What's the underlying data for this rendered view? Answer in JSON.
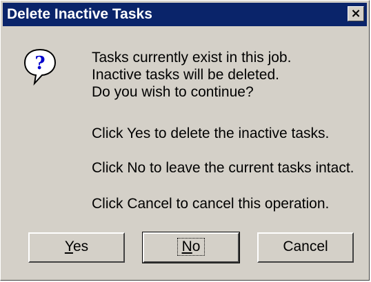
{
  "window": {
    "title": "Delete Inactive Tasks",
    "close_glyph": "×"
  },
  "icon": {
    "name": "question-icon",
    "glyph": "?"
  },
  "message": {
    "line1": "Tasks currently exist in this job.",
    "line2": "Inactive tasks will be deleted.",
    "line3": "Do you wish to continue?",
    "line4": "Click Yes to delete the inactive tasks.",
    "line5": "Click No to leave the current tasks intact.",
    "line6": "Click Cancel to cancel this operation."
  },
  "buttons": {
    "yes_mnemonic": "Y",
    "yes_rest": "es",
    "no_mnemonic": "N",
    "no_rest": "o",
    "cancel": "Cancel"
  }
}
